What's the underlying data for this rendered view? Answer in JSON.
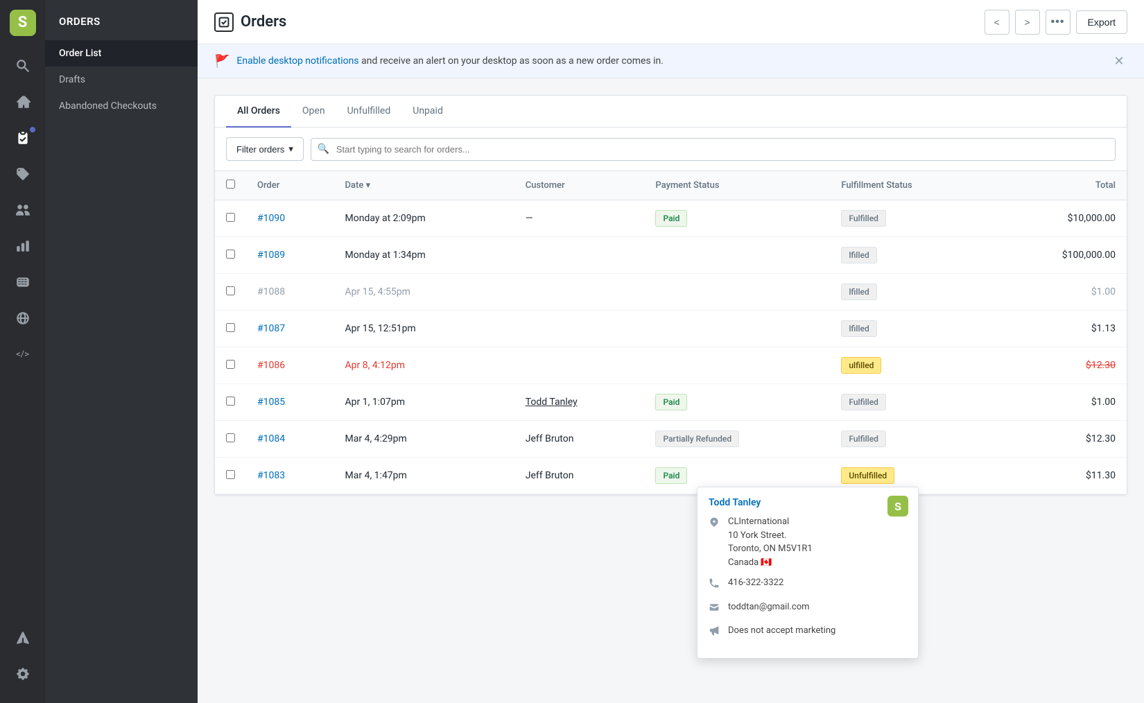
{
  "sidebar": {
    "logo_text": "S",
    "icons": [
      {
        "name": "search-icon",
        "symbol": "🔍"
      },
      {
        "name": "home-icon",
        "symbol": "🏠"
      },
      {
        "name": "orders-icon",
        "symbol": "☑"
      },
      {
        "name": "tags-icon",
        "symbol": "🏷"
      },
      {
        "name": "customers-icon",
        "symbol": "👥"
      },
      {
        "name": "analytics-icon",
        "symbol": "📊"
      },
      {
        "name": "discounts-icon",
        "symbol": "✂"
      },
      {
        "name": "online-store-icon",
        "symbol": "🌐"
      },
      {
        "name": "code-icon",
        "symbol": "</>"
      },
      {
        "name": "apps-icon",
        "symbol": "⚙"
      },
      {
        "name": "settings-icon",
        "symbol": "⚙"
      }
    ]
  },
  "nav": {
    "header": "Orders",
    "items": [
      {
        "label": "Order List",
        "active": true
      },
      {
        "label": "Drafts",
        "active": false
      },
      {
        "label": "Abandoned Checkouts",
        "active": false
      }
    ]
  },
  "header": {
    "page_icon": "✓",
    "title": "Orders",
    "prev_label": "<",
    "next_label": ">",
    "more_label": "•••",
    "export_label": "Export"
  },
  "notification": {
    "icon": "🚩",
    "link_text": "Enable desktop notifications",
    "rest_text": " and receive an alert on your desktop as soon as a new order comes in."
  },
  "tabs": [
    {
      "label": "All Orders",
      "active": true
    },
    {
      "label": "Open",
      "active": false
    },
    {
      "label": "Unfulfilled",
      "active": false
    },
    {
      "label": "Unpaid",
      "active": false
    }
  ],
  "filter": {
    "filter_label": "Filter orders",
    "search_placeholder": "Start typing to search for orders..."
  },
  "table": {
    "columns": [
      "Order",
      "Date",
      "Customer",
      "Payment Status",
      "Fulfillment Status",
      "Total"
    ],
    "rows": [
      {
        "order": "#1090",
        "order_style": "normal",
        "date": "Monday at 2:09pm",
        "date_style": "normal",
        "customer": "—",
        "customer_style": "dash",
        "payment_status": "Paid",
        "payment_badge": "paid",
        "fulfillment_status": "Fulfilled",
        "fulfillment_badge": "fulfilled",
        "total": "$10,000.00",
        "total_style": "normal"
      },
      {
        "order": "#1089",
        "order_style": "normal",
        "date": "Monday at 1:34pm",
        "date_style": "normal",
        "customer": "",
        "customer_style": "hidden",
        "payment_status": "",
        "payment_badge": "",
        "fulfillment_status": "lfilled",
        "fulfillment_badge": "fulfilled",
        "total": "$100,000.00",
        "total_style": "normal"
      },
      {
        "order": "#1088",
        "order_style": "disabled",
        "date": "Apr 15, 4:55pm",
        "date_style": "gray",
        "customer": "",
        "customer_style": "hidden",
        "payment_status": "",
        "payment_badge": "",
        "fulfillment_status": "lfilled",
        "fulfillment_badge": "fulfilled",
        "total": "$1.00",
        "total_style": "gray"
      },
      {
        "order": "#1087",
        "order_style": "normal",
        "date": "Apr 15, 12:51pm",
        "date_style": "normal",
        "customer": "",
        "customer_style": "hidden",
        "payment_status": "",
        "payment_badge": "",
        "fulfillment_status": "lfilled",
        "fulfillment_badge": "fulfilled",
        "total": "$1.13",
        "total_style": "normal"
      },
      {
        "order": "#1086",
        "order_style": "red",
        "date": "Apr 8, 4:12pm",
        "date_style": "red",
        "customer": "",
        "customer_style": "hidden",
        "payment_status": "",
        "payment_badge": "",
        "fulfillment_status": "ulfilled",
        "fulfillment_badge": "unfulfilled",
        "total": "$12.30",
        "total_style": "red-strikethrough"
      },
      {
        "order": "#1085",
        "order_style": "normal",
        "date": "Apr 1, 1:07pm",
        "date_style": "normal",
        "customer": "Todd Tanley",
        "customer_style": "underline",
        "payment_status": "Paid",
        "payment_badge": "paid",
        "fulfillment_status": "Fulfilled",
        "fulfillment_badge": "fulfilled",
        "total": "$1.00",
        "total_style": "normal"
      },
      {
        "order": "#1084",
        "order_style": "normal",
        "date": "Mar 4, 4:29pm",
        "date_style": "normal",
        "customer": "Jeff Bruton",
        "customer_style": "normal",
        "payment_status": "Partially Refunded",
        "payment_badge": "partial-refund",
        "fulfillment_status": "Fulfilled",
        "fulfillment_badge": "fulfilled",
        "total": "$12.30",
        "total_style": "normal"
      },
      {
        "order": "#1083",
        "order_style": "normal",
        "date": "Mar 4, 1:47pm",
        "date_style": "normal",
        "customer": "Jeff Bruton",
        "customer_style": "normal",
        "payment_status": "Paid",
        "payment_badge": "paid",
        "fulfillment_status": "Unfulfilled",
        "fulfillment_badge": "unfulfilled",
        "total": "$11.30",
        "total_style": "normal"
      }
    ]
  },
  "tooltip": {
    "title": "Todd Tanley",
    "company": "CLInternational",
    "address_line1": "10 York Street.",
    "address_line2": "Toronto, ON M5V1R1",
    "country": "Canada 🇨🇦",
    "phone": "416-322-3322",
    "email": "toddtan@gmail.com",
    "marketing": "Does not accept marketing"
  }
}
